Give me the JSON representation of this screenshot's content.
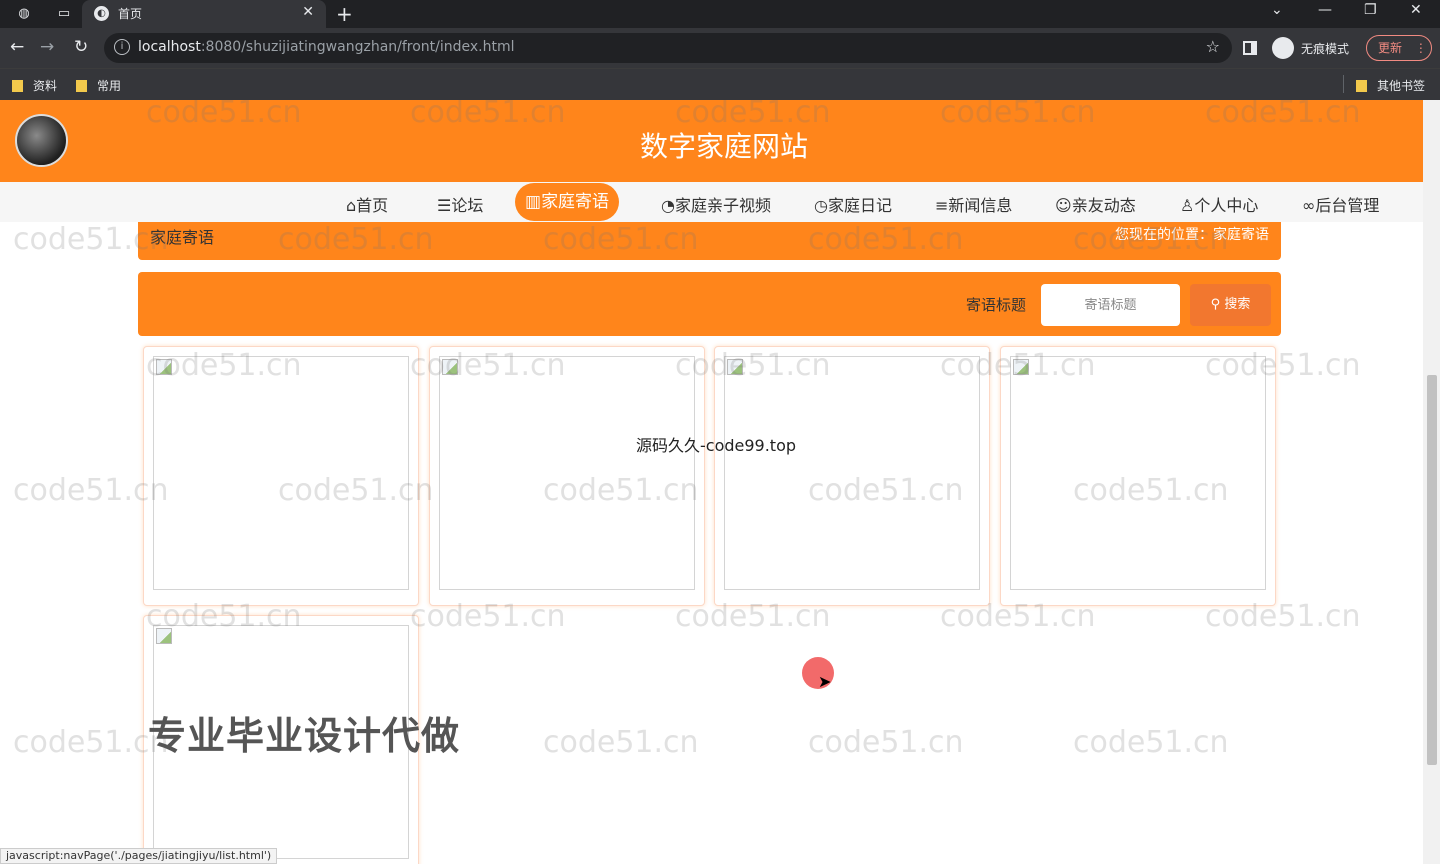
{
  "browser": {
    "tab_title": "首页",
    "url_host": "localhost",
    "url_rest": ":8080/shuzijiatingwangzhan/front/index.html",
    "incognito_label": "无痕模式",
    "update_label": "更新",
    "bookmarks": [
      "资料",
      "常用"
    ],
    "other_bookmarks": "其他书签"
  },
  "site": {
    "title": "数字家庭网站",
    "nav": [
      {
        "label": "首页",
        "icon": "home-icon",
        "glyph": "⌂"
      },
      {
        "label": "论坛",
        "icon": "layers-icon",
        "glyph": "☰"
      },
      {
        "label": "家庭寄语",
        "icon": "message-icon",
        "glyph": "▥",
        "active": true
      },
      {
        "label": "家庭亲子视频",
        "icon": "video-icon",
        "glyph": "◔"
      },
      {
        "label": "家庭日记",
        "icon": "clock-icon",
        "glyph": "◷"
      },
      {
        "label": "新闻信息",
        "icon": "filter-icon",
        "glyph": "≡"
      },
      {
        "label": "亲友动态",
        "icon": "paw-icon",
        "glyph": "☺"
      },
      {
        "label": "个人中心",
        "icon": "user-icon",
        "glyph": "♙"
      },
      {
        "label": "后台管理",
        "icon": "link-icon",
        "glyph": "∞"
      }
    ],
    "breadcrumb": {
      "section": "家庭寄语",
      "location": "您现在的位置：家庭寄语"
    },
    "search": {
      "label": "寄语标题",
      "placeholder": "寄语标题",
      "button": "搜索"
    }
  },
  "watermark": "code51.cn",
  "overlay": {
    "center": "源码久久-code99.top",
    "big": "专业毕业设计代做"
  },
  "status_url": "javascript:navPage('./pages/jiatingjiyu/list.html')",
  "colors": {
    "brand": "#ff851b",
    "chrome_dark": "#202124",
    "chrome": "#35363a"
  }
}
